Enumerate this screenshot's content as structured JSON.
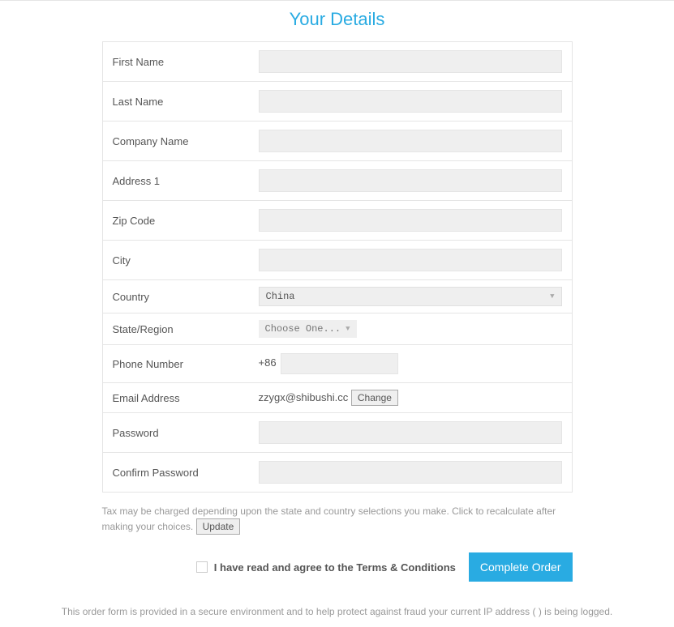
{
  "title": "Your Details",
  "fields": {
    "first_name": {
      "label": "First Name",
      "value": ""
    },
    "last_name": {
      "label": "Last Name",
      "value": ""
    },
    "company_name": {
      "label": "Company Name",
      "value": ""
    },
    "address1": {
      "label": "Address 1",
      "value": ""
    },
    "zip": {
      "label": "Zip Code",
      "value": ""
    },
    "city": {
      "label": "City",
      "value": ""
    },
    "country": {
      "label": "Country",
      "value": "China"
    },
    "state": {
      "label": "State/Region",
      "value": "Choose One..."
    },
    "phone": {
      "label": "Phone Number",
      "prefix": "+86",
      "value": ""
    },
    "email": {
      "label": "Email Address",
      "value": "zzygx@shibushi.cc",
      "change_btn": "Change"
    },
    "password": {
      "label": "Password",
      "value": ""
    },
    "confirm_password": {
      "label": "Confirm Password",
      "value": ""
    }
  },
  "tax_note": "Tax may be charged depending upon the state and country selections you make. Click to recalculate after making your choices.",
  "update_btn": "Update",
  "agree_label": "I have read and agree to the Terms & Conditions",
  "complete_btn": "Complete Order",
  "footer_left": "This order form is provided in a secure environment and to help protect against fraud your current IP address (",
  "footer_right": ") is being logged."
}
